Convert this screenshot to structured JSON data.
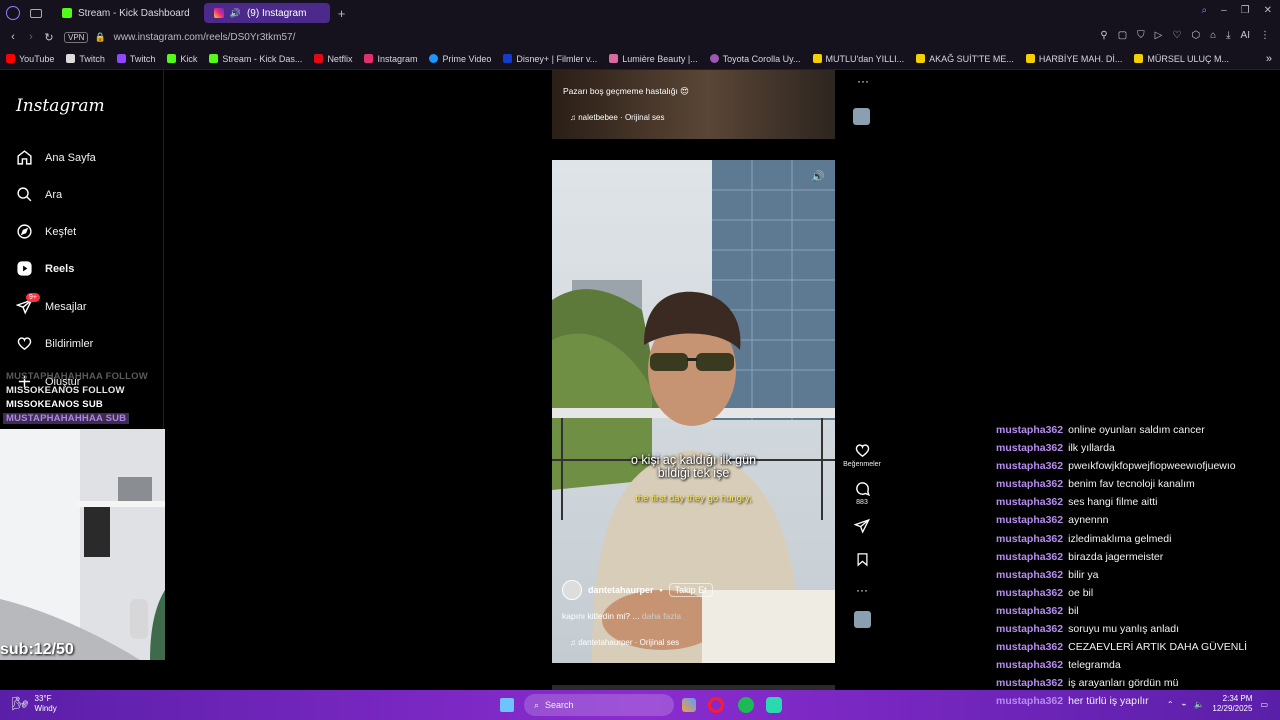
{
  "browser": {
    "tabs": [
      {
        "label": "Stream - Kick Dashboard",
        "icon": "kick-icon",
        "color": "#53fc18"
      },
      {
        "label": "(9) Instagram",
        "icon": "instagram-icon",
        "color": "#e1306c"
      }
    ],
    "url": "www.instagram.com/reels/DS0Yr3tkm57/",
    "vpn_label": "VPN",
    "bookmarks": [
      {
        "label": "YouTube",
        "color": "#ff0000"
      },
      {
        "label": "Twitch",
        "color": "#9146ff"
      },
      {
        "label": "Twitch",
        "color": "#9146ff"
      },
      {
        "label": "Kick",
        "color": "#53fc18"
      },
      {
        "label": "Stream - Kick Das...",
        "color": "#53fc18"
      },
      {
        "label": "Netflix",
        "color": "#e50914"
      },
      {
        "label": "Instagram",
        "color": "#e1306c"
      },
      {
        "label": "Prime Video",
        "color": "#1a98ff"
      },
      {
        "label": "Disney+ | Filmler v...",
        "color": "#113ccf"
      },
      {
        "label": "Lumière Beauty |...",
        "color": "#d96aa0"
      },
      {
        "label": "Toyota Corolla Uy...",
        "color": "#9b59b6"
      },
      {
        "label": "MUTLU'dan YILLI...",
        "color": "#f4d000"
      },
      {
        "label": "AKAĞ SUİT'TE ME...",
        "color": "#f4d000"
      },
      {
        "label": "HARBİYE MAH. Dİ...",
        "color": "#f4d000"
      },
      {
        "label": "MÜRSEL ULUÇ M...",
        "color": "#f4d000"
      }
    ]
  },
  "instagram": {
    "logo": "Instagram",
    "nav": [
      {
        "label": "Ana Sayfa",
        "icon": "home-icon"
      },
      {
        "label": "Ara",
        "icon": "search-icon"
      },
      {
        "label": "Keşfet",
        "icon": "compass-icon"
      },
      {
        "label": "Reels",
        "icon": "reels-icon"
      },
      {
        "label": "Mesajlar",
        "icon": "messages-icon",
        "badge": "9+"
      },
      {
        "label": "Bildirimler",
        "icon": "heart-icon"
      },
      {
        "label": "Oluştur",
        "icon": "plus-icon"
      }
    ],
    "prev_reel": {
      "caption": "Pazarı boş geçmeme hastalığı 😍",
      "audio": "naletbebee · Orijinal ses"
    },
    "reel": {
      "subtitle_tr_1": "o kişi aç kaldığı ilk gün",
      "subtitle_tr_2": "bildiği tek işe",
      "subtitle_en": "the first day they go hungry,",
      "username": "dantetahaurper",
      "follow_label": "Takip Et",
      "caption": "kapını kitledin mi? ...",
      "more_label": "daha fazla",
      "audio": "dantetahaurper · Orijinal ses"
    },
    "actions": {
      "like_label": "Beğenmeler",
      "comment_count": "883"
    }
  },
  "stream": {
    "alerts": [
      {
        "text": "MUSTAPHAHAHHAA  FOLLOW",
        "color": "#5a5a5a"
      },
      {
        "text": "MISSOKEANOS  FOLLOW",
        "color": "#e8e8e8"
      },
      {
        "text": "MISSOKEANOS  SUB",
        "color": "#ffffff"
      },
      {
        "text": "MUSTAPHAHAHHAA  SUB",
        "color": "#b084e8"
      }
    ],
    "sub_counter": "sub:12/50",
    "chat": [
      {
        "user": "mustapha362",
        "msg": "online oyunları saldım cancer"
      },
      {
        "user": "mustapha362",
        "msg": "ilk yıllarda"
      },
      {
        "user": "mustapha362",
        "msg": "pweıkfowjkfopwejfiopweewıofjuewıo"
      },
      {
        "user": "mustapha362",
        "msg": "benim fav tecnoloji kanalım"
      },
      {
        "user": "mustapha362",
        "msg": "ses hangi filme aitti"
      },
      {
        "user": "mustapha362",
        "msg": "aynennn"
      },
      {
        "user": "mustapha362",
        "msg": "izledimaklıma gelmedi"
      },
      {
        "user": "mustapha362",
        "msg": "birazda jagermeister"
      },
      {
        "user": "mustapha362",
        "msg": "bilir ya"
      },
      {
        "user": "mustapha362",
        "msg": "oe bil"
      },
      {
        "user": "mustapha362",
        "msg": "bil"
      },
      {
        "user": "mustapha362",
        "msg": "soruyu mu yanlış anladı"
      },
      {
        "user": "mustapha362",
        "msg": "CEZAEVLERİ ARTIK DAHA GÜVENLİ"
      },
      {
        "user": "mustapha362",
        "msg": "telegramda"
      },
      {
        "user": "mustapha362",
        "msg": "iş arayanları gördün mü"
      },
      {
        "user": "mustapha362",
        "msg": "her türlü iş yapılır"
      }
    ]
  },
  "taskbar": {
    "weather_temp": "33°F",
    "weather_desc": "Windy",
    "search_placeholder": "Search",
    "time": "2:34 PM",
    "date": "12/29/2025"
  }
}
